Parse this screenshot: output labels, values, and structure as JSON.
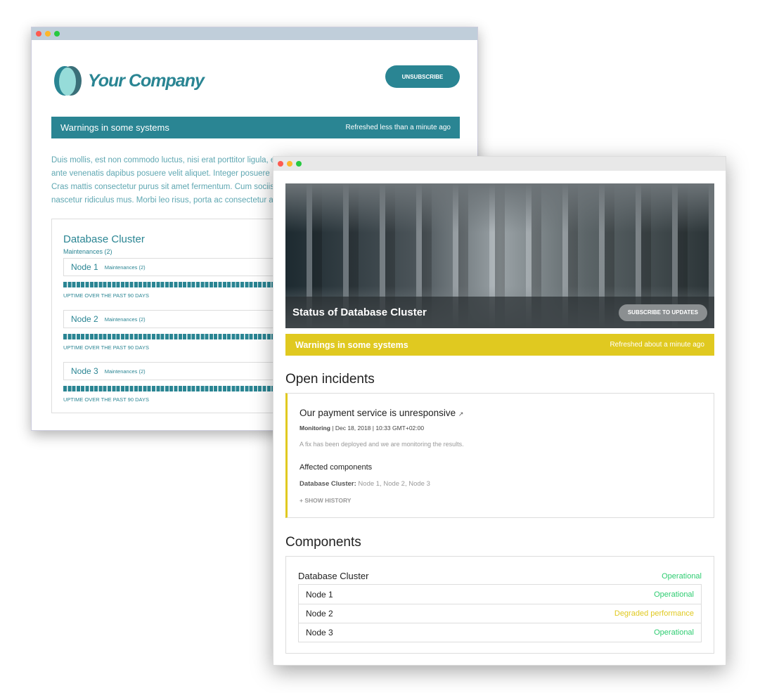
{
  "back_window": {
    "company": "Your Company",
    "unsubscribe": "UNSUBSCRIBE",
    "banner": {
      "title": "Warnings in some systems",
      "status": "Refreshed less than a minute ago"
    },
    "paragraph": [
      "Duis mollis, est non commodo luctus, nisi erat porttitor ligula, e",
      "ante venenatis dapibus posuere velit aliquet. Integer posuere",
      "Cras mattis consectetur purus sit amet fermentum. Cum sociis",
      "nascetur ridiculus mus. Morbi leo risus, porta ac consectetur a"
    ],
    "cluster": {
      "title": "Database Cluster",
      "maintenances": "Maintenances (2)",
      "nodes": [
        {
          "name": "Node 1",
          "maintenances": "Maintenances (2)",
          "uptime": "UPTIME OVER THE PAST 90 DAYS"
        },
        {
          "name": "Node 2",
          "maintenances": "Maintenances (2)",
          "uptime": "UPTIME OVER THE PAST 90 DAYS"
        },
        {
          "name": "Node 3",
          "maintenances": "Maintenances (2)",
          "uptime": "UPTIME OVER THE PAST 90 DAYS"
        }
      ]
    },
    "colors": {
      "brand": "#2a8593"
    }
  },
  "front_window": {
    "hero": {
      "title": "Status of Database Cluster",
      "subscribe": "SUBSCRIBE TO UPDATES"
    },
    "banner": {
      "title": "Warnings in some systems",
      "status": "Refreshed about a minute ago"
    },
    "incidents_heading": "Open incidents",
    "incident": {
      "title": "Our payment service is unresponsive",
      "status": "Monitoring",
      "meta": " | Dec 18, 2018 | 10:33 GMT+02:00",
      "description": "A fix has been deployed and we are monitoring the results.",
      "affected_heading": "Affected components",
      "affected_group": "Database Cluster:",
      "affected_list": " Node 1, Node 2, Node 3",
      "show_history": "+ SHOW HISTORY"
    },
    "components_heading": "Components",
    "components": {
      "group": "Database Cluster",
      "group_status": "Operational",
      "items": [
        {
          "name": "Node 1",
          "status": "Operational"
        },
        {
          "name": "Node 2",
          "status": "Degraded performance"
        },
        {
          "name": "Node 3",
          "status": "Operational"
        }
      ]
    },
    "colors": {
      "warning": "#e0c920",
      "operational": "#2ecc71"
    }
  }
}
